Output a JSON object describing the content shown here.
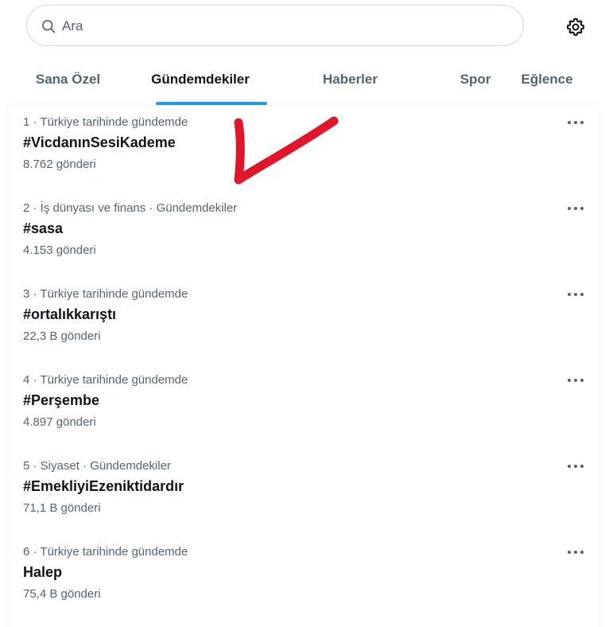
{
  "search": {
    "placeholder": "Ara",
    "icon": "search-icon"
  },
  "settings": {
    "icon": "gear-icon"
  },
  "tabs": [
    {
      "label": "Sana Özel",
      "active": false
    },
    {
      "label": "Gündemdekiler",
      "active": true
    },
    {
      "label": "Haberler",
      "active": false
    },
    {
      "label": "Spor",
      "active": false
    },
    {
      "label": "Eğlence",
      "active": false
    }
  ],
  "trends": [
    {
      "meta": "1 · Türkiye tarihinde gündemde",
      "title": "#VicdanınSesiKademe",
      "count": "8.762 gönderi"
    },
    {
      "meta": "2 · İş dünyası ve finans · Gündemdekiler",
      "title": "#sasa",
      "count": "4.153 gönderi"
    },
    {
      "meta": "3 · Türkiye tarihinde gündemde",
      "title": "#ortalıkkarıştı",
      "count": "22,3 B gönderi"
    },
    {
      "meta": "4 · Türkiye tarihinde gündemde",
      "title": "#Perşembe",
      "count": "4.897 gönderi"
    },
    {
      "meta": "5 · Siyaset · Gündemdekiler",
      "title": "#EmekliyiEzeniktidardır",
      "count": "71,1 B gönderi"
    },
    {
      "meta": "6 · Türkiye tarihinde gündemde",
      "title": "Halep",
      "count": "75,4 B gönderi"
    }
  ],
  "colors": {
    "accent": "#1d9bf0",
    "annotation": "#e0162b",
    "secondary_text": "#536471",
    "primary_text": "#0f1419"
  }
}
